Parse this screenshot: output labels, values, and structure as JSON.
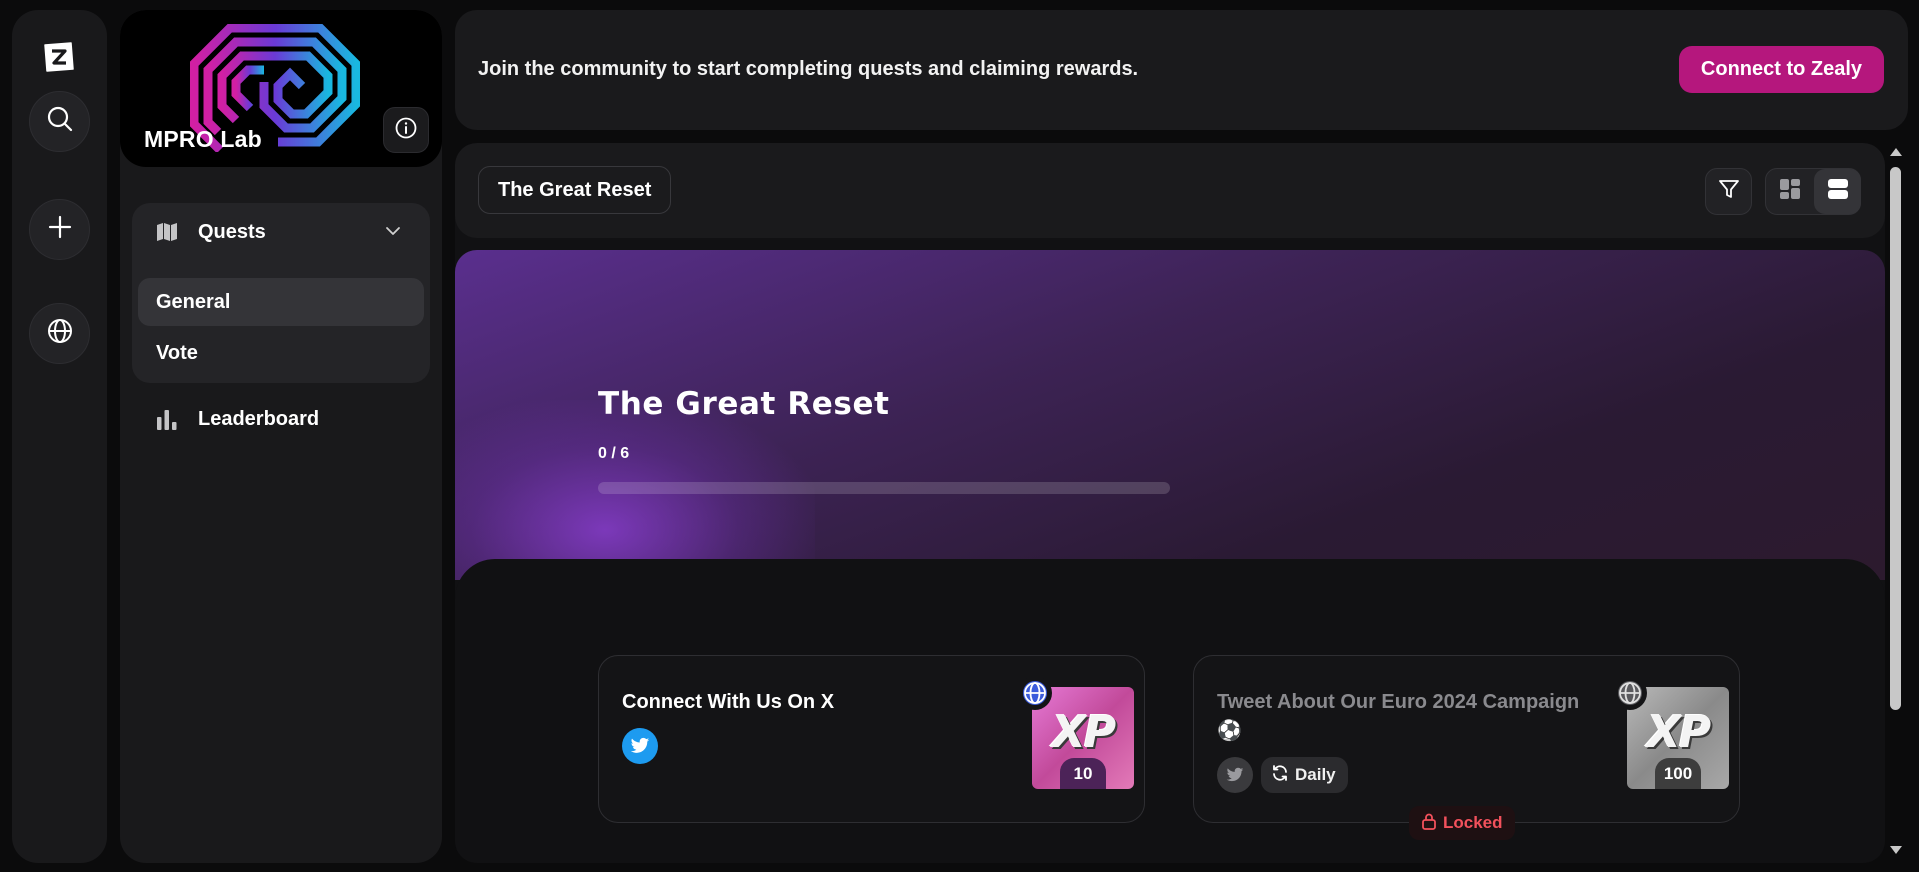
{
  "rail": {
    "logo_icon": "zealy-z-logo-icon",
    "buttons": [
      {
        "icon": "search-icon"
      },
      {
        "icon": "plus-icon"
      },
      {
        "icon": "globe-icon"
      }
    ]
  },
  "community": {
    "name": "MPRO Lab",
    "logo_icon": "maze-logo-icon",
    "info_icon": "info-icon"
  },
  "nav": {
    "quests_label": "Quests",
    "sub_items": [
      "General",
      "Vote"
    ],
    "active_sub_item": "General",
    "leaderboard_label": "Leaderboard"
  },
  "banner": {
    "text": "Join the community to start completing quests and claiming rewards.",
    "button_label": "Connect to Zealy"
  },
  "toolbar": {
    "module_label": "The Great Reset",
    "filter_icon": "filter-icon",
    "views": [
      "grid-view-icon",
      "list-view-icon"
    ],
    "selected_view": "list-view-icon"
  },
  "hero": {
    "title": "The Great Reset",
    "progress_text": "0 / 6",
    "progress_fraction": 0
  },
  "quests": [
    {
      "title": "Connect With Us On X",
      "xp": "10",
      "locked": false,
      "tags": [],
      "xp_tile_text": "XP"
    },
    {
      "title": "Tweet About Our Euro 2024 Campaign ⚽",
      "xp": "100",
      "locked": true,
      "tags": [
        "Daily"
      ],
      "locked_label": "Locked",
      "xp_tile_text": "XP"
    }
  ],
  "colors": {
    "accent": "#b5177d",
    "twitter_blue": "#1d9bf0",
    "locked_red": "#f2515c",
    "hero_purple": "#7b3fc4"
  }
}
